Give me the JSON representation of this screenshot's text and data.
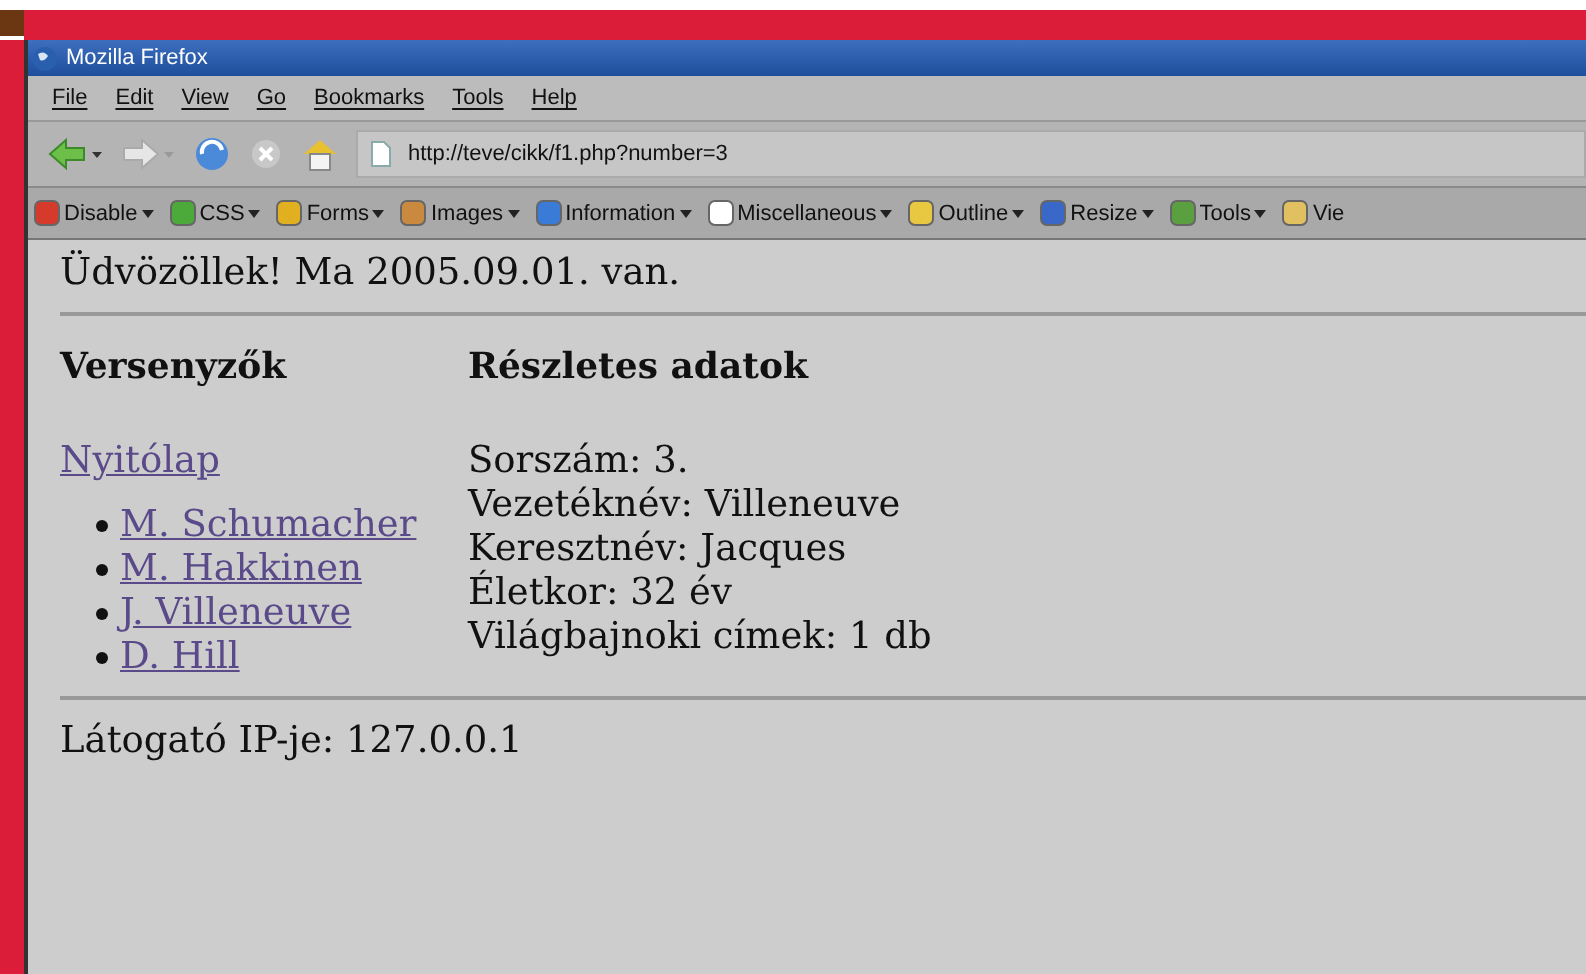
{
  "window": {
    "title": "Mozilla Firefox"
  },
  "menu": [
    "File",
    "Edit",
    "View",
    "Go",
    "Bookmarks",
    "Tools",
    "Help"
  ],
  "address": {
    "value": "http://teve/cikk/f1.php?number=3"
  },
  "toolbar": [
    "Disable",
    "CSS",
    "Forms",
    "Images",
    "Information",
    "Miscellaneous",
    "Outline",
    "Resize",
    "Tools",
    "Vie"
  ],
  "page": {
    "greeting": "Üdvözöllek! Ma 2005.09.01. van.",
    "left_heading": "Versenyzők",
    "right_heading": "Részletes adatok",
    "home_link": "Nyitólap",
    "drivers": [
      "M. Schumacher",
      "M. Hakkinen",
      "J. Villeneuve",
      "D. Hill"
    ],
    "details": [
      "Sorszám: 3.",
      "Vezetéknév: Villeneuve",
      "Keresztnév: Jacques",
      "Életkor: 32 év",
      "Világbajnoki címek: 1 db"
    ],
    "footer": "Látogató IP-je: 127.0.0.1"
  }
}
